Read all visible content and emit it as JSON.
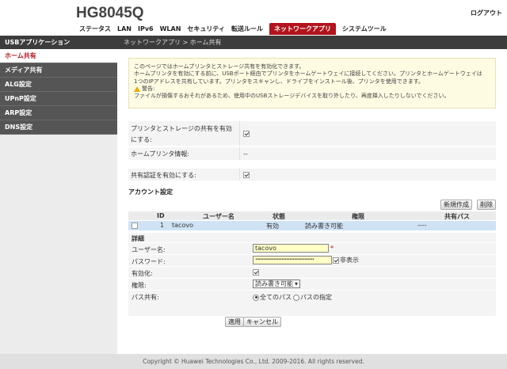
{
  "header": {
    "model": "HG8045Q",
    "logout": "ログアウト",
    "nav": [
      {
        "label": "ステータス"
      },
      {
        "label": "LAN"
      },
      {
        "label": "IPv6"
      },
      {
        "label": "WLAN"
      },
      {
        "label": "セキュリティ"
      },
      {
        "label": "転送ルール"
      },
      {
        "label": "ネットワークアプリ",
        "active": true
      },
      {
        "label": "システムツール"
      }
    ]
  },
  "sidebar": {
    "heading": "USBアプリケーション",
    "items": [
      {
        "label": "ホーム共有",
        "active": true
      },
      {
        "label": "メディア共有"
      },
      {
        "label": "ALG設定"
      },
      {
        "label": "UPnP設定"
      },
      {
        "label": "ARP設定"
      },
      {
        "label": "DNS設定"
      }
    ]
  },
  "breadcrumb": "ネットワークアプリ > ホーム共有",
  "info": {
    "line1": "このページではホームプリンタとストレージ共有を有効化できます。",
    "line2": "ホームプリンタを有効にする前に、USBポート経由でプリンタをホームゲートウェイに接続してください。プリンタとホームゲートウェイは",
    "line3": "1つのIPアドレスを共有しています。プリンタをスキャンし、ドライブをインストール後、プリンタを使用できます。",
    "warning_label": "警告:",
    "line4": "ファイルが損傷するおそれがあるため、使用中のUSBストレージデバイスを取り外したり、再度挿入したりしないでください。"
  },
  "form": {
    "share_label": "プリンタとストレージの共有を有効にする:",
    "share_checked": true,
    "printer_info_label": "ホームプリンタ情報:",
    "printer_info_value": "--",
    "auth_label": "共有認証を有効にする:",
    "auth_checked": true
  },
  "accounts": {
    "title": "アカウント設定",
    "new_button": "新規作成",
    "delete_button": "削除",
    "columns": [
      "ID",
      "ユーザー名",
      "状態",
      "権限",
      "共有パス"
    ],
    "rows": [
      {
        "id": "1",
        "user": "tacovo",
        "status": "有効",
        "perm": "読み書き可能",
        "path": "----"
      }
    ]
  },
  "detail": {
    "title": "詳細",
    "username_label": "ユーザー名:",
    "username_value": "tacovo",
    "required_mark": "*",
    "password_label": "パスワード:",
    "password_mask": "••••••••••••••••••••••••••••••••••••••",
    "hide_label": "非表示",
    "enable_label": "有効化:",
    "perm_label": "権限:",
    "perm_value": "読み書き可能",
    "path_label": "パス共有:",
    "path_all": "全てのパス",
    "path_specific": "パスの指定"
  },
  "buttons": {
    "apply": "適用",
    "cancel": "キャンセル"
  },
  "footer": "Copyright © Huawei Technologies Co., Ltd. 2009-2016. All rights reserved.",
  "colors": {
    "accent": "#b2131c",
    "sidebar_dark": "#3c3c3c",
    "info_bg": "#fdfbe2",
    "selected_row": "#cfe3f5"
  }
}
